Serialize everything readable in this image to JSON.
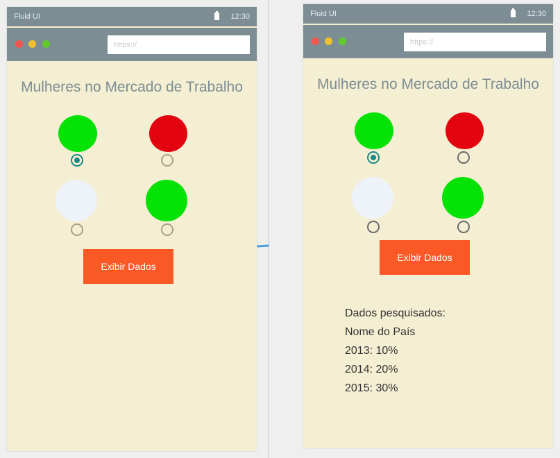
{
  "phone": {
    "status_title": "Fluid UI",
    "status_time": "12:30",
    "url_placeholder": "https://"
  },
  "page": {
    "title": "Mulheres no Mercado de Trabalho",
    "button_label": "Exibir Dados"
  },
  "options": [
    {
      "name": "option-1",
      "color": "#05e205",
      "selected": true
    },
    {
      "name": "option-2",
      "color": "#e2050f",
      "selected": false
    },
    {
      "name": "option-3",
      "color": "#eef3fa",
      "selected": false
    },
    {
      "name": "option-4",
      "color": "#05e205",
      "selected": false
    }
  ],
  "results": {
    "heading": "Dados pesquisados:",
    "country": "Nome do País",
    "rows": [
      "2013: 10%",
      "2014: 20%",
      "2015: 30%"
    ]
  }
}
